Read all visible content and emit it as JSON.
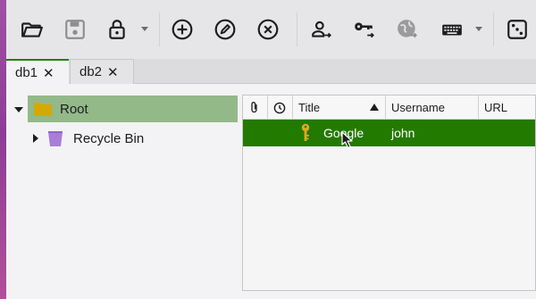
{
  "toolbar": {
    "buttons": [
      {
        "name": "open-database",
        "icon": "folder-open-icon"
      },
      {
        "name": "save-database",
        "icon": "floppy-disk-icon"
      },
      {
        "name": "lock-database",
        "icon": "lock-icon"
      },
      {
        "name": "add-entry",
        "icon": "plus-circle-icon"
      },
      {
        "name": "edit-entry",
        "icon": "pencil-circle-icon"
      },
      {
        "name": "delete-entry",
        "icon": "x-circle-icon"
      },
      {
        "name": "copy-username",
        "icon": "user-arrow-icon"
      },
      {
        "name": "copy-password",
        "icon": "key-arrow-icon"
      },
      {
        "name": "open-url",
        "icon": "globe-arrow-icon"
      },
      {
        "name": "autotype",
        "icon": "keyboard-icon"
      },
      {
        "name": "password-generator",
        "icon": "dice-icon"
      }
    ]
  },
  "tabs": [
    {
      "label": "db1",
      "close": "✕",
      "active": true
    },
    {
      "label": "db2",
      "close": "✕",
      "active": false
    }
  ],
  "tree": {
    "root": {
      "label": "Root",
      "icon": "folder-icon",
      "color": "#d4a900"
    },
    "recycle": {
      "label": "Recycle Bin",
      "icon": "trash-icon",
      "color": "#a77fd6"
    }
  },
  "table": {
    "columns": {
      "attachment": "paperclip-icon",
      "modified": "clock-icon",
      "title": "Title",
      "username": "Username",
      "url": "URL"
    },
    "rows": [
      {
        "icon": "key-icon",
        "title": "Google",
        "username": "john",
        "url": ""
      }
    ]
  },
  "colors": {
    "selected_row": "#237a00",
    "selected_group": "#93b989",
    "active_tab_accent": "#2a7a1a"
  }
}
